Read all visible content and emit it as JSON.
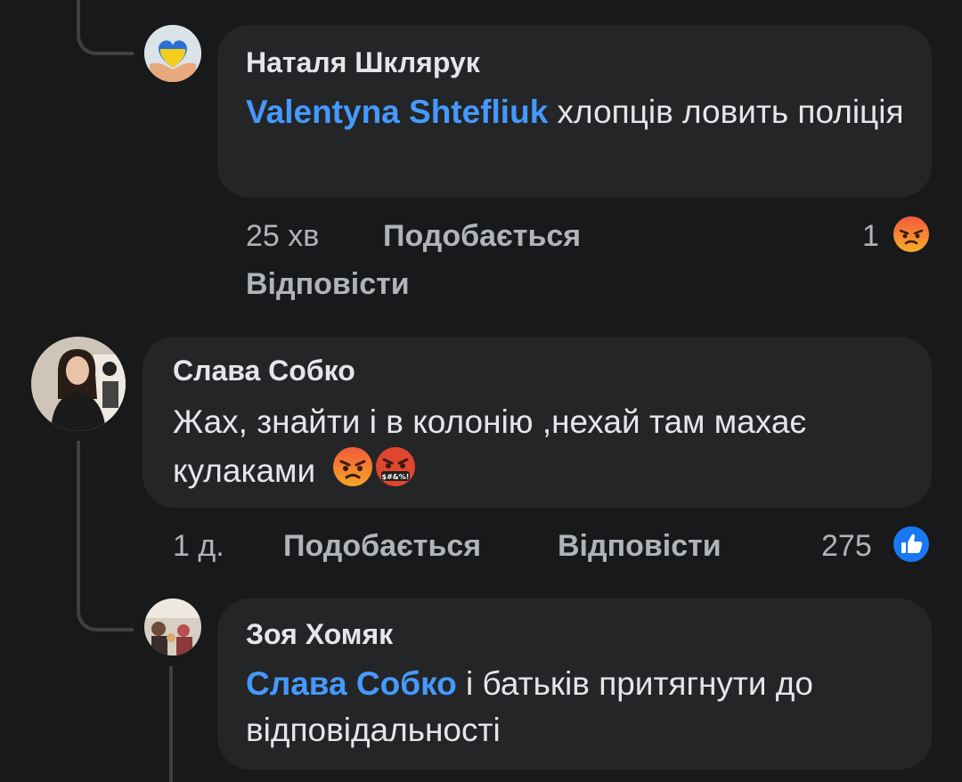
{
  "comments": [
    {
      "author": "Наталя Шклярук",
      "mention": "Valentyna Shtefliuk",
      "text": " хлопців ловить поліція",
      "time": "25 хв",
      "like_label": "Подобається",
      "reply_label": "Відповісти",
      "reaction_count": "1",
      "reaction_icon": "angry-reaction-icon"
    },
    {
      "author": "Слава Собко",
      "text": "Жах, знайти і в колонію ,нехай там махає кулаками",
      "emojis": [
        "angry-face-emoji",
        "cursing-face-emoji"
      ],
      "time": "1 д.",
      "like_label": "Подобається",
      "reply_label": "Відповісти",
      "reaction_count": "275",
      "reaction_icon": "like-reaction-icon"
    },
    {
      "author": "Зоя Хомяк",
      "mention": "Слава Собко",
      "text": " і батьків притягнути до відповідальності"
    }
  ],
  "colors": {
    "background": "#18191a",
    "bubble": "#242526",
    "mention": "#4599ff",
    "meta": "#b0b3b8",
    "angry": "#f0533a",
    "like": "#1877f2"
  }
}
